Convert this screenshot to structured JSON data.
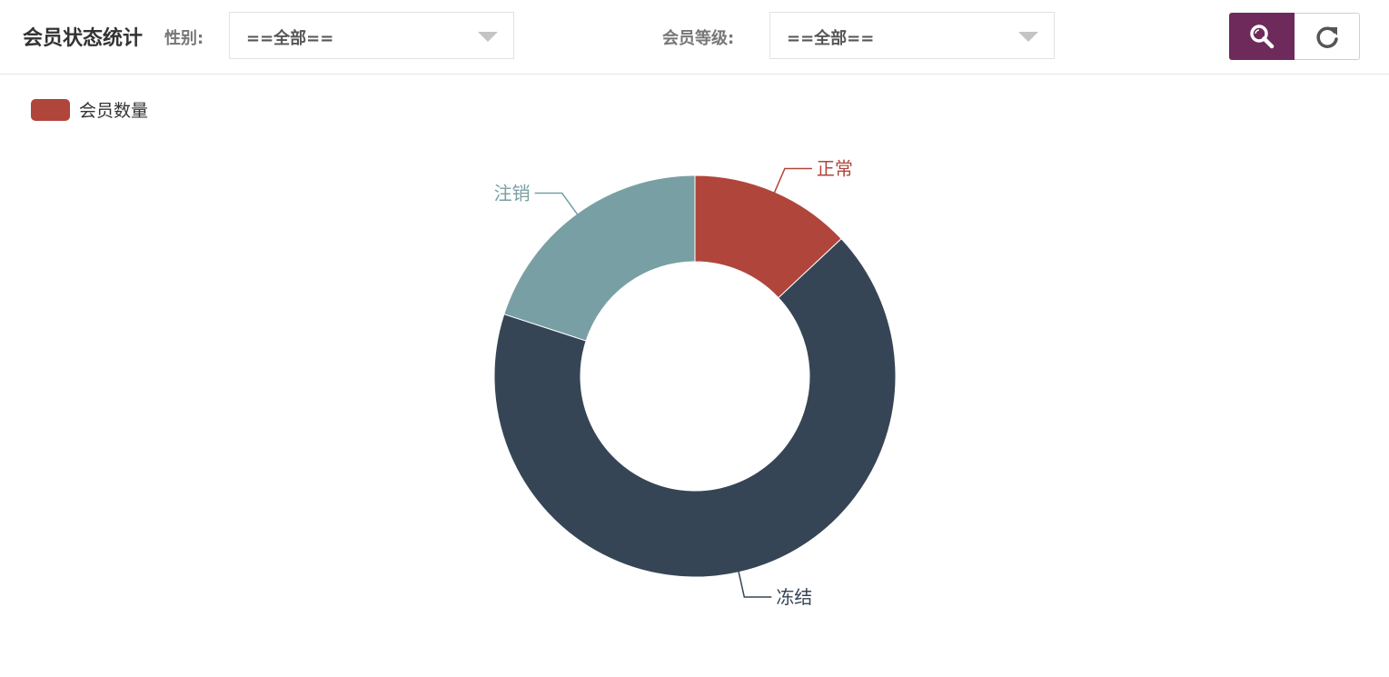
{
  "header": {
    "title": "会员状态统计",
    "gender_label": "性别:",
    "gender_value": "==全部==",
    "level_label": "会员等级:",
    "level_value": "==全部=="
  },
  "buttons": {
    "search_icon": "search-icon",
    "refresh_icon": "refresh-icon",
    "search_color": "#6d2a5b"
  },
  "chart_data": {
    "type": "pie",
    "style": "donut",
    "series": [
      {
        "name": "会员数量",
        "color": "#b0453c",
        "slices": [
          {
            "label": "正常",
            "value": 13,
            "color": "#b0453c"
          },
          {
            "label": "冻结",
            "value": 67,
            "color": "#364555"
          },
          {
            "label": "注销",
            "value": 20,
            "color": "#789fa4"
          }
        ]
      }
    ],
    "legend": {
      "position": "top-left",
      "entries": [
        "会员数量"
      ]
    }
  }
}
